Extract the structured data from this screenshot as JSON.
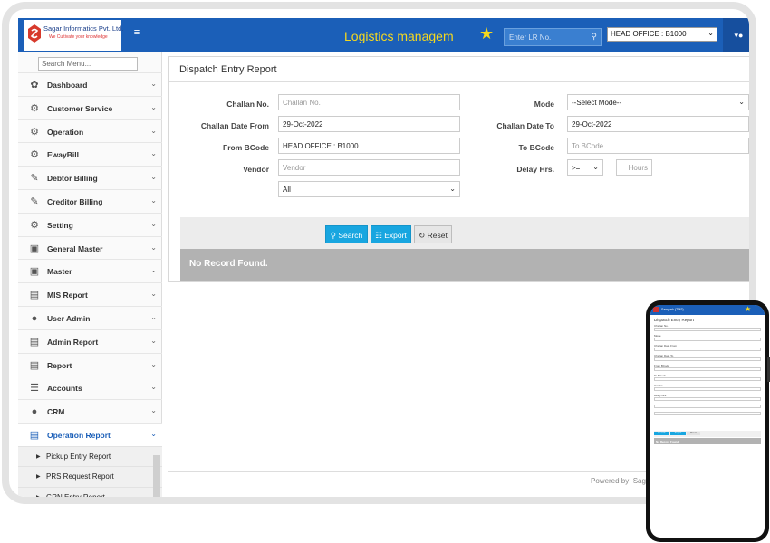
{
  "header": {
    "company": "Sagar Informatics Pvt. Ltd.",
    "tagline": "We Cultivate your knowledge",
    "app_title": "Logistics managem",
    "lr_placeholder": "Enter LR No.",
    "office": "HEAD OFFICE : B1000",
    "menu_icon": "hamburger-icon",
    "star_icon": "star-icon",
    "user_icon": "user-icon"
  },
  "sidebar": {
    "search_placeholder": "Search Menu...",
    "items": [
      {
        "label": "Dashboard",
        "icon": "palette-icon"
      },
      {
        "label": "Customer Service",
        "icon": "gear-icon"
      },
      {
        "label": "Operation",
        "icon": "gear-icon"
      },
      {
        "label": "EwayBill",
        "icon": "gear-icon"
      },
      {
        "label": "Debtor Billing",
        "icon": "edit-icon"
      },
      {
        "label": "Creditor Billing",
        "icon": "edit-icon"
      },
      {
        "label": "Setting",
        "icon": "gear-icon"
      },
      {
        "label": "General Master",
        "icon": "briefcase-icon"
      },
      {
        "label": "Master",
        "icon": "briefcase-icon"
      },
      {
        "label": "MIS Report",
        "icon": "bar-chart-icon"
      },
      {
        "label": "User Admin",
        "icon": "user-icon"
      },
      {
        "label": "Admin Report",
        "icon": "bar-chart-icon"
      },
      {
        "label": "Report",
        "icon": "bar-chart-icon"
      },
      {
        "label": "Accounts",
        "icon": "list-icon"
      },
      {
        "label": "CRM",
        "icon": "users-icon"
      },
      {
        "label": "Operation Report",
        "icon": "bar-chart-icon"
      }
    ],
    "sub_items": [
      {
        "label": "Pickup Entry Report"
      },
      {
        "label": "PRS Request Report"
      },
      {
        "label": "GRN Entry Report"
      }
    ]
  },
  "form": {
    "title": "Dispatch Entry Report",
    "challan_no_label": "Challan No.",
    "challan_no_placeholder": "Challan No.",
    "mode_label": "Mode",
    "mode_value": "--Select Mode--",
    "date_from_label": "Challan Date From",
    "date_from_value": "29-Oct-2022",
    "date_to_label": "Challan Date To",
    "date_to_value": "29-Oct-2022",
    "from_bcode_label": "From BCode",
    "from_bcode_value": "HEAD OFFICE : B1000",
    "to_bcode_label": "To BCode",
    "to_bcode_placeholder": "To BCode",
    "vendor_label": "Vendor",
    "vendor_placeholder": "Vendor",
    "delay_label": "Delay Hrs.",
    "delay_op": ">=",
    "hours_placeholder": "Hours",
    "all_value": "All"
  },
  "actions": {
    "search": "Search",
    "export": "Export",
    "reset": "Reset"
  },
  "result": {
    "no_record": "No Record Found."
  },
  "footer": {
    "powered": "Powered by: Sagar Infor"
  },
  "phone": {
    "app_name": "Sampark (TMS)",
    "title": "Dispatch Entry Report",
    "fields": [
      "Challan No.",
      "Mode",
      "Challan Date From",
      "Challan Date To",
      "From BCode",
      "To BCode",
      "Vendor",
      "Delay Hrs."
    ],
    "search": "Search",
    "export": "Export",
    "reset": "Reset",
    "no_record": "No Record Found."
  }
}
